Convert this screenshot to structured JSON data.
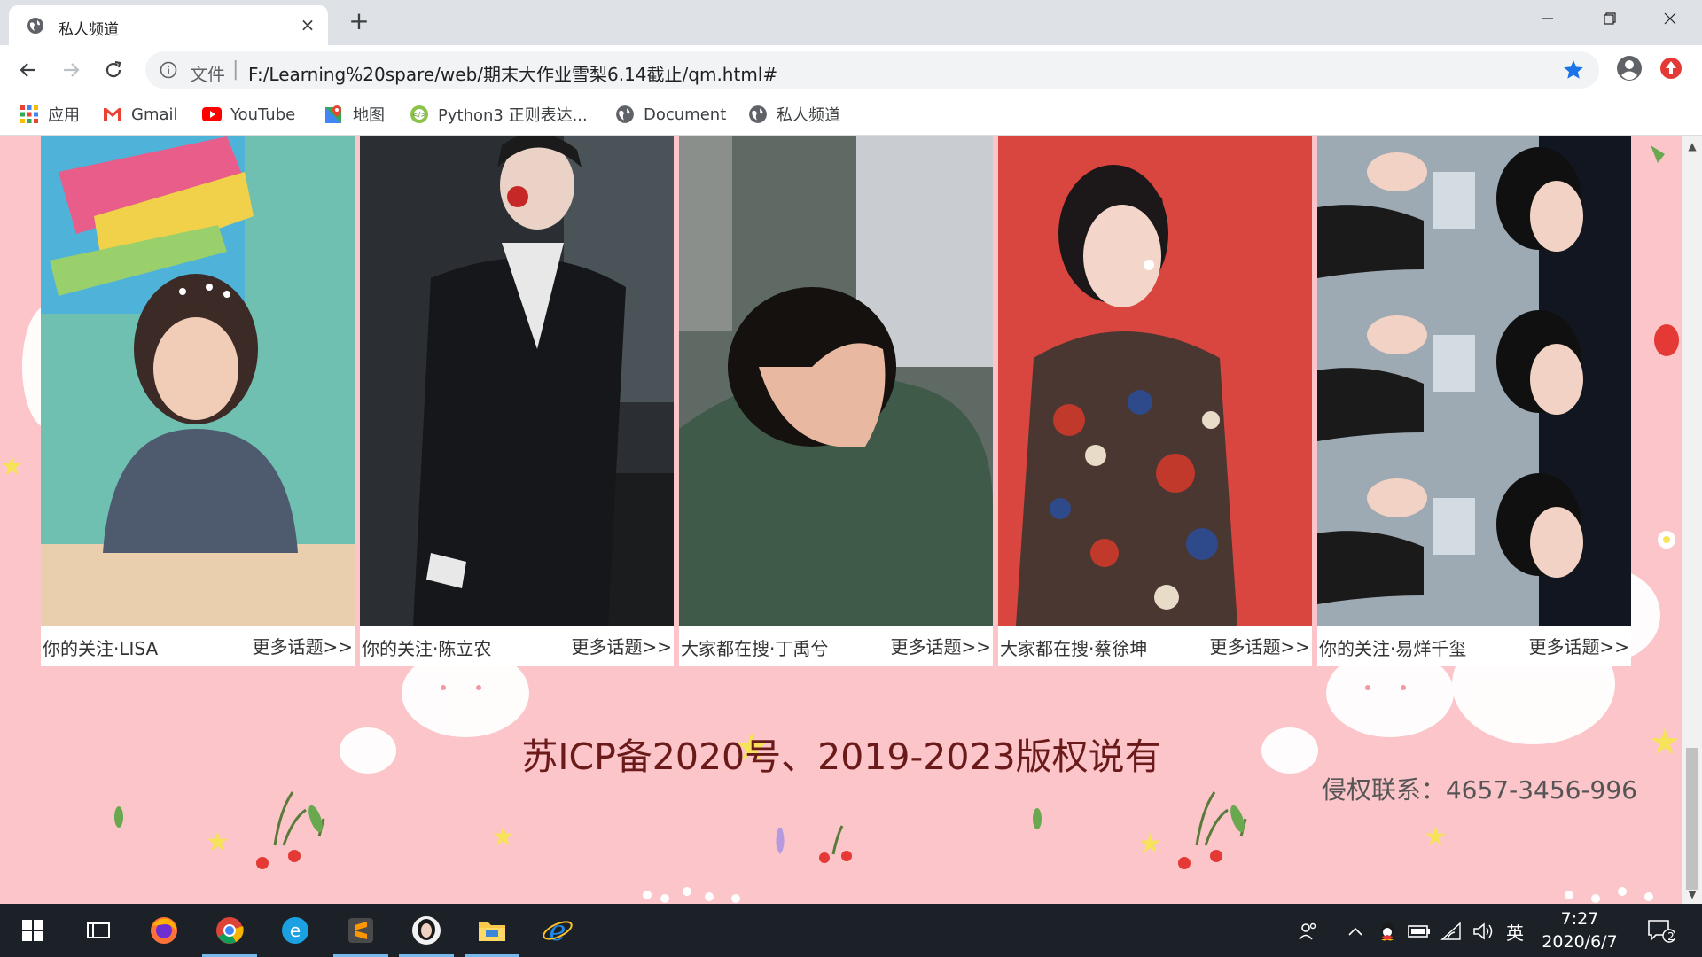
{
  "browser": {
    "tab_title": "私人频道",
    "tab_close": "×",
    "new_tab": "+",
    "address_scheme": "文件",
    "address_separator": "|",
    "url": "F:/Learning%20spare/web/期末大作业雪梨6.14截止/qm.html#"
  },
  "bookmarks": [
    {
      "label": "应用",
      "icon": "apps-grid-icon"
    },
    {
      "label": "Gmail",
      "icon": "gmail-icon"
    },
    {
      "label": "YouTube",
      "icon": "youtube-icon"
    },
    {
      "label": "地图",
      "icon": "maps-icon"
    },
    {
      "label": "Python3 正则表达...",
      "icon": "python-site-icon"
    },
    {
      "label": "Document",
      "icon": "globe-icon"
    },
    {
      "label": "私人频道",
      "icon": "globe-icon"
    }
  ],
  "cards": [
    {
      "caption": "你的关注·LISA",
      "more": "更多话题>>"
    },
    {
      "caption": "你的关注·陈立农",
      "more": "更多话题>>"
    },
    {
      "caption": "大家都在搜·丁禹兮",
      "more": "更多话题>>"
    },
    {
      "caption": "大家都在搜·蔡徐坤",
      "more": "更多话题>>"
    },
    {
      "caption": "你的关注·易烊千玺",
      "more": "更多话题>>"
    }
  ],
  "footer": {
    "copyright": "苏ICP备2020号、2019-2023版权说有",
    "contact": "侵权联系：4657-3456-996"
  },
  "taskbar": {
    "time": "7:27",
    "date": "2020/6/7",
    "ime": "英",
    "notification_count": "2"
  },
  "colors": {
    "page_background": "#fbc5c9",
    "footer_text": "#6b1a1a",
    "taskbar": "#1c2127",
    "accent_star": "#1a73e8"
  }
}
